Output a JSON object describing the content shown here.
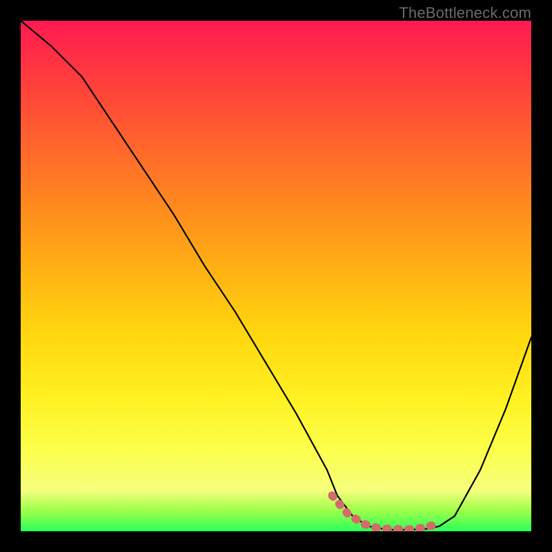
{
  "watermark": "TheBottleneck.com",
  "chart_data": {
    "type": "line",
    "title": "",
    "xlabel": "",
    "ylabel": "",
    "xlim": [
      0,
      100
    ],
    "ylim": [
      0,
      100
    ],
    "grid": false,
    "legend": false,
    "annotations": [],
    "series": [
      {
        "name": "main-curve",
        "color": "#000000",
        "x": [
          0,
          6,
          12,
          18,
          24,
          30,
          36,
          42,
          48,
          54,
          60,
          62,
          65,
          68,
          72,
          76,
          80,
          82,
          85,
          90,
          95,
          100
        ],
        "y": [
          100,
          95,
          89,
          80,
          71,
          62,
          52,
          43,
          33,
          23,
          12,
          7,
          3,
          1,
          0.3,
          0.3,
          0.5,
          1,
          3,
          12,
          24,
          38
        ]
      },
      {
        "name": "trough-highlight",
        "color": "#d36b6b",
        "x": [
          61,
          64,
          67,
          70,
          73,
          76,
          79,
          82
        ],
        "y": [
          7,
          3.5,
          1.5,
          0.6,
          0.4,
          0.4,
          0.7,
          1.5
        ]
      }
    ]
  }
}
